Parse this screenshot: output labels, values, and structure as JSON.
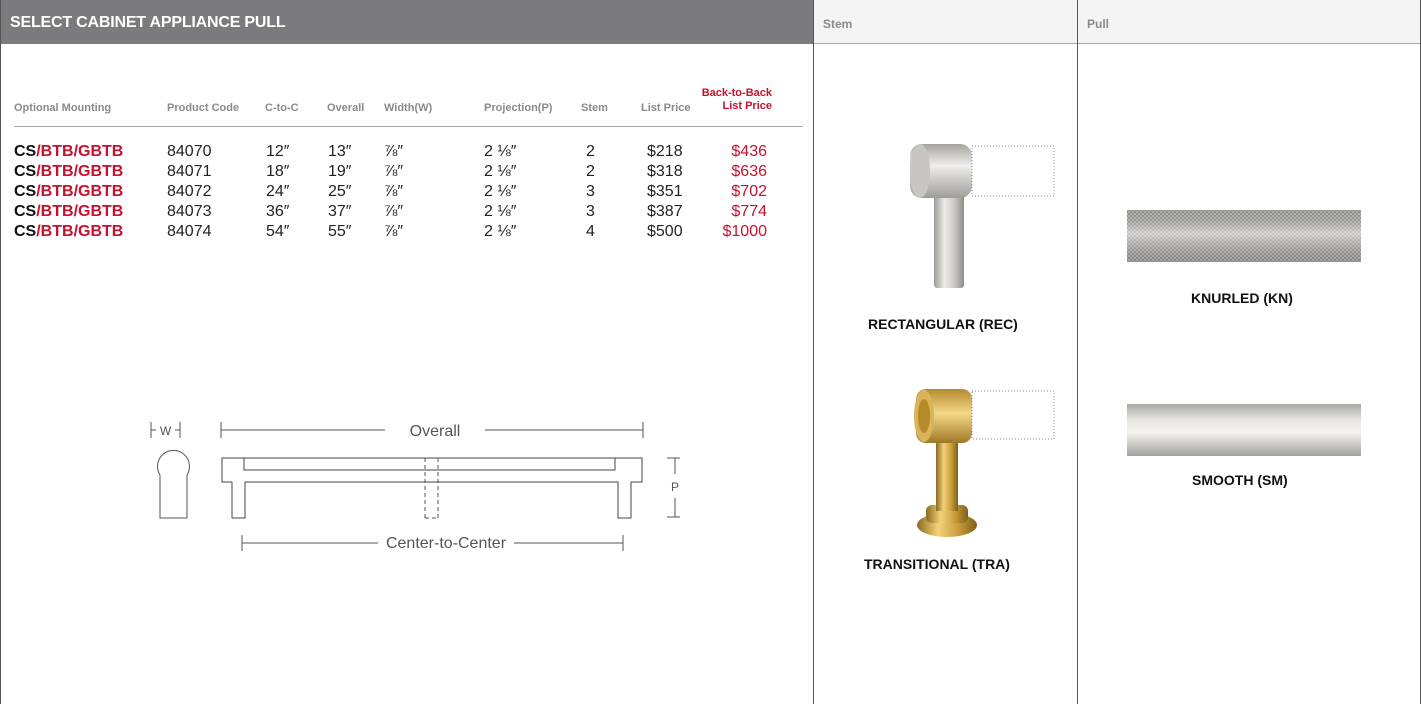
{
  "header": {
    "title": "SELECT CABINET APPLIANCE PULL",
    "stem_label": "Stem",
    "pull_label": "Pull"
  },
  "table": {
    "columns": {
      "mounting": "Optional Mounting",
      "code": "Product Code",
      "ctoc": "C-to-C",
      "overall": "Overall",
      "width": "Width(W)",
      "projection": "Projection(P)",
      "stem": "Stem",
      "list_price": "List Price",
      "btb_price_line1": "Back-to-Back",
      "btb_price_line2": "List Price"
    },
    "rows": [
      {
        "cs": "CS",
        "btb": "/BTB/GBTB",
        "code": "84070",
        "ctoc": "12″",
        "overall": "13″",
        "width": "⅞″",
        "projection": "2 ⅛″",
        "stem": "2",
        "price": "$218",
        "btb_price": "$436"
      },
      {
        "cs": "CS",
        "btb": "/BTB/GBTB",
        "code": "84071",
        "ctoc": "18″",
        "overall": "19″",
        "width": "⅞″",
        "projection": "2 ⅛″",
        "stem": "2",
        "price": "$318",
        "btb_price": "$636"
      },
      {
        "cs": "CS",
        "btb": "/BTB/GBTB",
        "code": "84072",
        "ctoc": "24″",
        "overall": "25″",
        "width": "⅞″",
        "projection": "2 ⅛″",
        "stem": "3",
        "price": "$351",
        "btb_price": "$702"
      },
      {
        "cs": "CS",
        "btb": "/BTB/GBTB",
        "code": "84073",
        "ctoc": "36″",
        "overall": "37″",
        "width": "⅞″",
        "projection": "2 ⅛″",
        "stem": "3",
        "price": "$387",
        "btb_price": "$774"
      },
      {
        "cs": "CS",
        "btb": "/BTB/GBTB",
        "code": "84074",
        "ctoc": "54″",
        "overall": "55″",
        "width": "⅞″",
        "projection": "2 ⅛″",
        "stem": "4",
        "price": "$500",
        "btb_price": "$1000"
      }
    ]
  },
  "diagram": {
    "overall": "Overall",
    "center_to_center": "Center-to-Center",
    "w": "W",
    "p": "P"
  },
  "stems": [
    {
      "name": "RECTANGULAR (REC)",
      "finish": "satin-nickel"
    },
    {
      "name": "TRANSITIONAL (TRA)",
      "finish": "brass"
    }
  ],
  "pulls": [
    {
      "name": "KNURLED (KN)",
      "finish": "satin-nickel"
    },
    {
      "name": "SMOOTH (SM)",
      "finish": "satin-nickel"
    }
  ],
  "colors": {
    "header_bg": "#7b7b7d",
    "accent_red": "#c8102e",
    "header_text": "#8a8a8a"
  }
}
